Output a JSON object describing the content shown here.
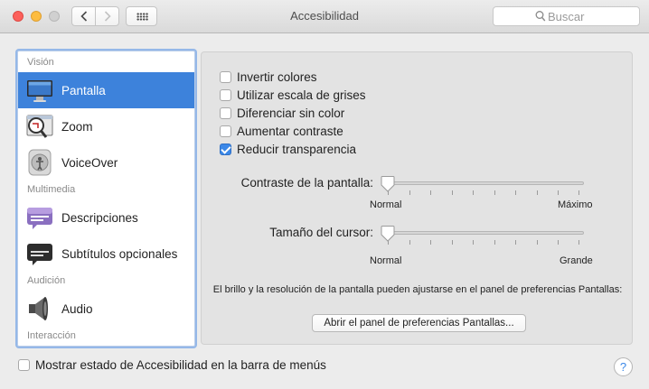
{
  "window": {
    "title": "Accesibilidad",
    "search_placeholder": "Buscar"
  },
  "sidebar": {
    "sections": [
      "Visión",
      "Multimedia",
      "Audición",
      "Interacción"
    ],
    "items": [
      {
        "label": "Pantalla",
        "icon": "display-icon",
        "selected": true
      },
      {
        "label": "Zoom",
        "icon": "zoom-icon",
        "selected": false
      },
      {
        "label": "VoiceOver",
        "icon": "voiceover-icon",
        "selected": false
      },
      {
        "label": "Descripciones",
        "icon": "speech-bubble-icon",
        "selected": false
      },
      {
        "label": "Subtítulos opcionales",
        "icon": "captions-icon",
        "selected": false
      },
      {
        "label": "Audio",
        "icon": "speaker-icon",
        "selected": false
      }
    ]
  },
  "options": [
    {
      "label": "Invertir colores",
      "checked": false
    },
    {
      "label": "Utilizar escala de grises",
      "checked": false
    },
    {
      "label": "Diferenciar sin color",
      "checked": false
    },
    {
      "label": "Aumentar contraste",
      "checked": false
    },
    {
      "label": "Reducir transparencia",
      "checked": true
    }
  ],
  "sliders": {
    "contrast": {
      "label": "Contraste de la pantalla:",
      "min_label": "Normal",
      "max_label": "Máximo",
      "value": 0
    },
    "cursor": {
      "label": "Tamaño del cursor:",
      "min_label": "Normal",
      "max_label": "Grande",
      "value": 0
    }
  },
  "note": "El brillo y la resolución de la pantalla pueden ajustarse en el panel de preferencias Pantallas:",
  "open_displays_button": "Abrir el panel de preferencias Pantallas...",
  "menu_bar_option": {
    "label": "Mostrar estado de Accesibilidad en la barra de menús",
    "checked": false
  },
  "help_label": "?",
  "colors": {
    "selection": "#3d82db",
    "accent": "#3b88e8"
  }
}
